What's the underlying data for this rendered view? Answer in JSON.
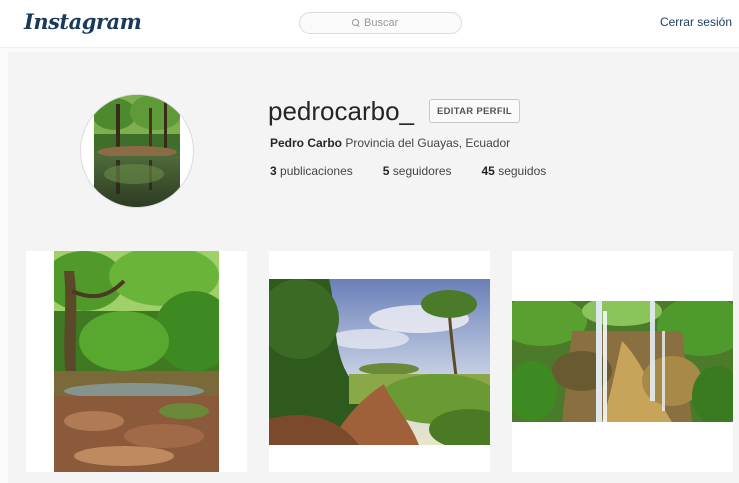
{
  "header": {
    "logo": "Instagram",
    "search_placeholder": "Buscar",
    "logout_label": "Cerrar sesión"
  },
  "profile": {
    "username": "pedrocarbo_",
    "edit_label": "EDITAR PERFIL",
    "full_name": "Pedro Carbo",
    "location": "Provincia del Guayas, Ecuador",
    "stats": [
      {
        "count": "3",
        "label": "publicaciones"
      },
      {
        "count": "5",
        "label": "seguidores"
      },
      {
        "count": "45",
        "label": "seguidos"
      }
    ]
  },
  "posts": [
    {
      "subject": "forest-stream-photo"
    },
    {
      "subject": "dirt-path-landscape-photo"
    },
    {
      "subject": "waterfall-photo"
    }
  ],
  "colors": {
    "brand_text": "#1a3a5c",
    "background": "#f4f4f4",
    "border": "#dbdbdb"
  }
}
